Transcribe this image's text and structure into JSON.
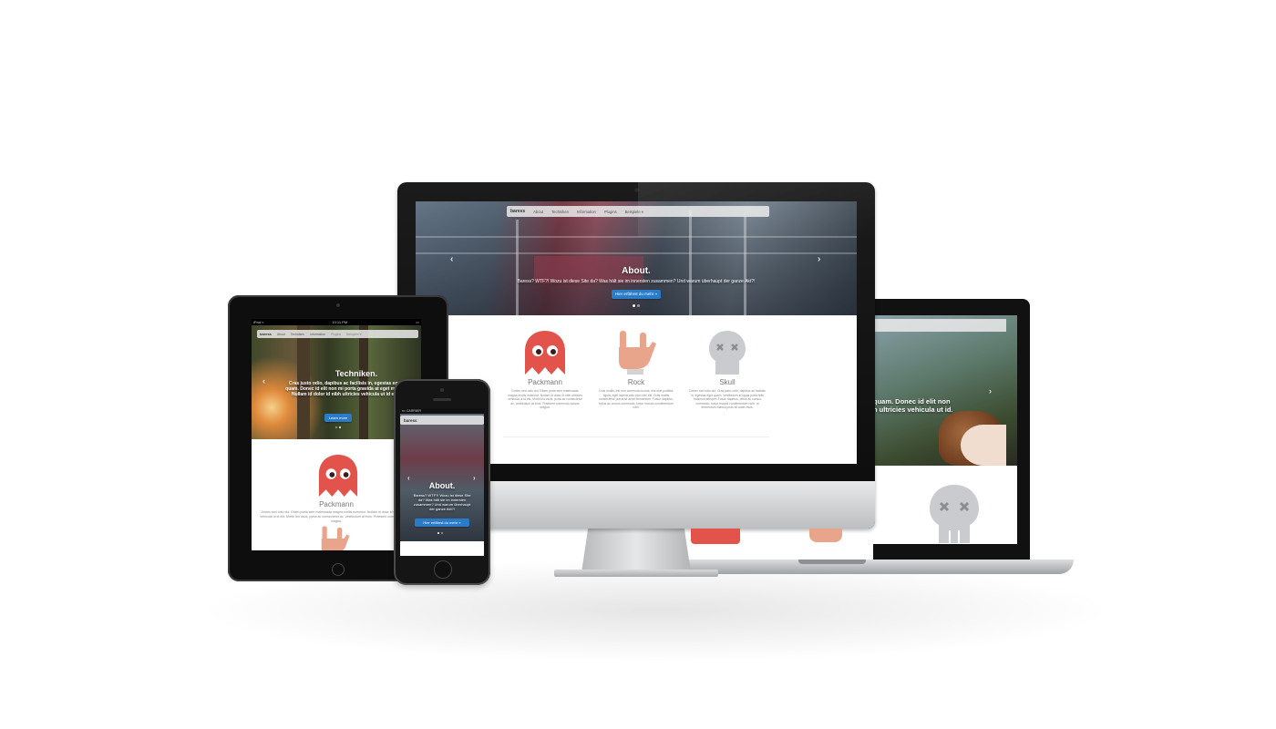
{
  "imac": {
    "nav": {
      "brand": "baress",
      "items": [
        "About",
        "Techniken",
        "Information",
        "Plugins",
        "Beispiele ▾"
      ]
    },
    "hero": {
      "title": "About.",
      "text": "Baress? WTF?! Wozu ist diese Site da? Was hält sie im innersten zusammen? Und warum überhaupt der ganze Akt?!",
      "button": "Hier erfährst du mehr »"
    },
    "features": [
      {
        "title": "Packmann",
        "icon": "ghost-icon",
        "text": "Donec sed odio dui. Etiam porta sem malesuada magna mollis euismod. Nullam id dolor id nibh ultricies vehicula ut id elit. Morbi leo risus, porta ac consectetur ac, vestibulum at eros. Praesent commodo cursus magna."
      },
      {
        "title": "Rock",
        "icon": "rock-hand-icon",
        "text": "Duis mollis, est non commodo luctus, nisi erat porttitor ligula, eget lacinia odio sem nec elit. Cras mattis consectetur purus sit amet fermentum. Fusce dapibus, tellus ac cursus commodo, tortor mauris condimentum nibh."
      },
      {
        "title": "Skull",
        "icon": "skull-icon",
        "text": "Donec sed odio dui. Cras justo odio, dapibus ac facilisis in, egestas eget quam. Vestibulum id ligula porta felis euismod semper. Fusce dapibus, tellus ac cursus commodo, tortor mauris condimentum nibh, ut fermentum massa justo sit amet risus."
      }
    ]
  },
  "ipad": {
    "status": {
      "carrier": "iPad ≈",
      "time": "10:11 PM"
    },
    "nav": {
      "brand": "baress",
      "items": [
        "About",
        "Techniken",
        "Information",
        "Plugins",
        "Beispiele ▾"
      ]
    },
    "hero": {
      "title": "Techniken.",
      "text": "Cras justo odio, dapibus ac facilisis in, egestas eget quam. Donec id elit non mi porta gravida at eget metus. Nullam id dolor id nibh ultricies vehicula ut id elit.",
      "button": "Learn more"
    },
    "feature": {
      "title": "Packmann",
      "text": "Donec sed odio dui. Etiam porta sem malesuada magna mollis euismod. Nullam id dolor id nibh ultricies vehicula ut id elit. Morbi leo risus, porta ac consectetur ac, vestibulum at eros. Praesent commodo cursus magna."
    }
  },
  "iphone": {
    "status": {
      "carrier": "▪▪▪ CARRIER",
      "time": ""
    },
    "nav": {
      "brand": "baress"
    },
    "hero": {
      "title": "About.",
      "text": "Baress? WTF?! Wozu ist diese Site da? Was hält sie im innersten zusammen? Und warum überhaupt der ganze Akt?!",
      "button": "Hier erfährst du mehr »"
    }
  },
  "laptop": {
    "hero": {
      "text": "quam. Donec id elit non\nh ultricies vehicula ut id."
    }
  },
  "colors": {
    "accent_blue": "#2a7cc9",
    "ghost_red": "#e2544b",
    "skull_gray": "#c9cbce",
    "hand_skin": "#e8a58c"
  }
}
